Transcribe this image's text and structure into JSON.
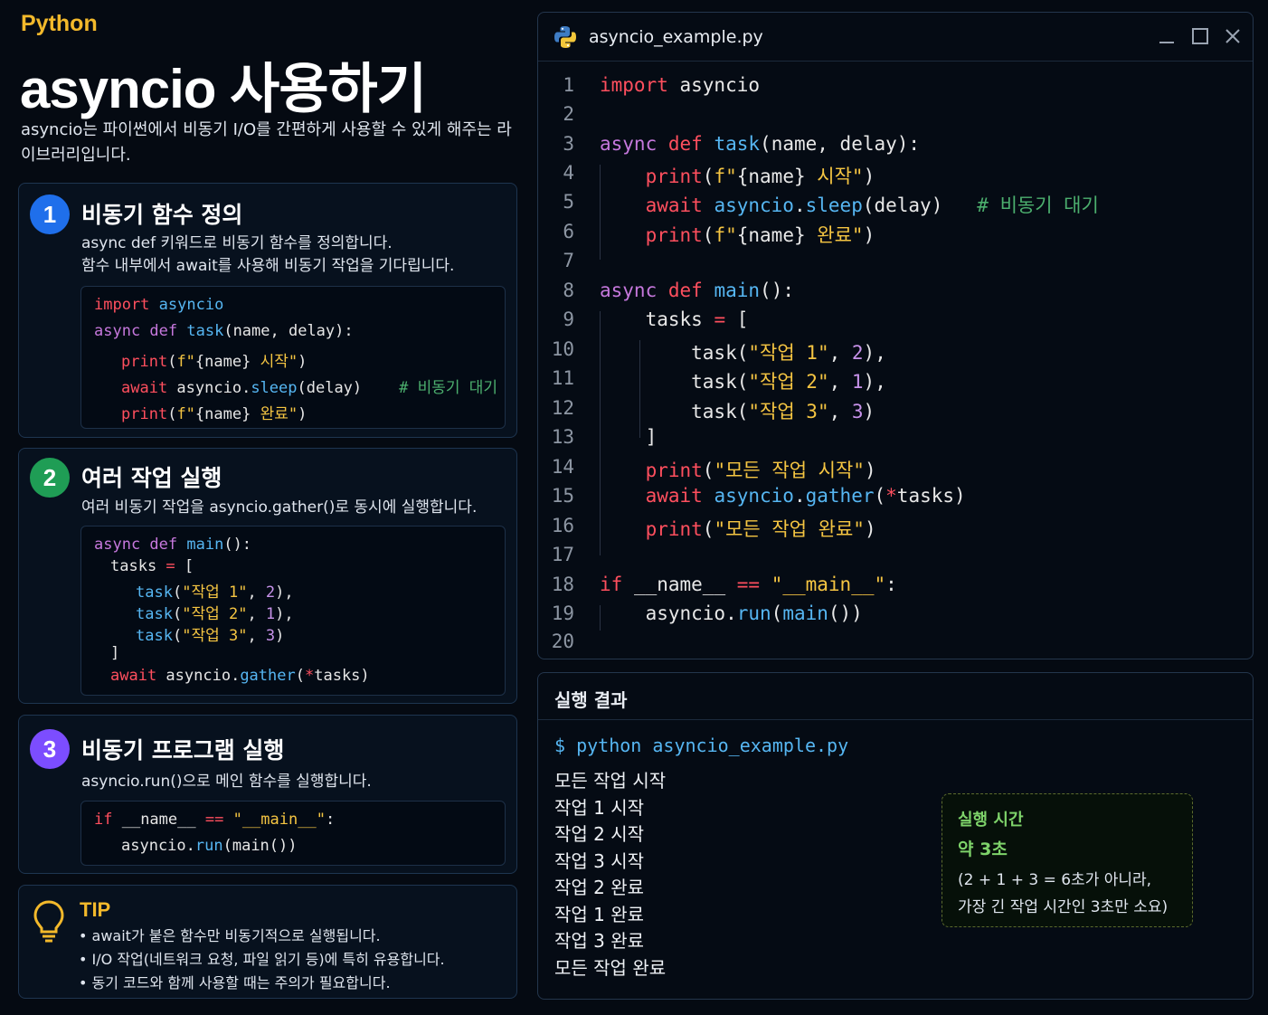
{
  "header": {
    "brand": "Python",
    "title": "asyncio 사용하기",
    "subtitle": "asyncio는 파이썬에서 비동기 I/O를 간편하게 사용할 수 있게 해주는 라이브러리입니다."
  },
  "steps": [
    {
      "number": "1",
      "color": "#1f6feb",
      "title": "비동기 함수 정의",
      "desc": [
        "async def 키워드로 비동기 함수를 정의합니다.",
        "함수 내부에서 await를 사용해 비동기 작업을 기다립니다."
      ]
    },
    {
      "number": "2",
      "color": "#1f9d55",
      "title": "여러 작업 실행",
      "desc": [
        "여러 비동기 작업을 asyncio.gather()로 동시에 실행합니다."
      ]
    },
    {
      "number": "3",
      "color": "#7c4dff",
      "title": "비동기 프로그램 실행",
      "desc": [
        "asyncio.run()으로 메인 함수를 실행합니다."
      ]
    }
  ],
  "tip": {
    "title": "TIP",
    "items": [
      "• await가 붙은 함수만 비동기적으로 실행됩니다.",
      "• I/O 작업(네트워크 요청, 파일 읽기 등)에 특히 유용합니다.",
      "• 동기 코드와 함께 사용할 때는 주의가 필요합니다."
    ]
  },
  "editor": {
    "filename": "asyncio_example.py",
    "line_numbers": [
      "1",
      "2",
      "3",
      "4",
      "5",
      "6",
      "7",
      "8",
      "9",
      "10",
      "11",
      "12",
      "13",
      "14",
      "15",
      "16",
      "17",
      "18",
      "19",
      "20"
    ]
  },
  "result": {
    "title": "실행 결과",
    "command": "$ python asyncio_example.py",
    "output": [
      "모든 작업 시작",
      "작업 1 시작",
      "작업 2 시작",
      "작업 3 시작",
      "작업 2 완료",
      "작업 1 완료",
      "작업 3 완료",
      "모든 작업 완료"
    ],
    "time_label": "실행 시간",
    "time_value": "약 3초",
    "time_note": [
      "(2 + 1 + 3 = 6초가 아니라,",
      "가장 긴 작업 시간인 3초만 소요)"
    ]
  },
  "colors": {
    "brand": "#f3b92b",
    "keyword_red": "#ff4f5e",
    "keyword_purple": "#c678dd",
    "function_blue": "#56b6f2",
    "string_yellow": "#f5c542",
    "comment_green": "#4caf6e",
    "highlight_green": "#7ed36a"
  }
}
